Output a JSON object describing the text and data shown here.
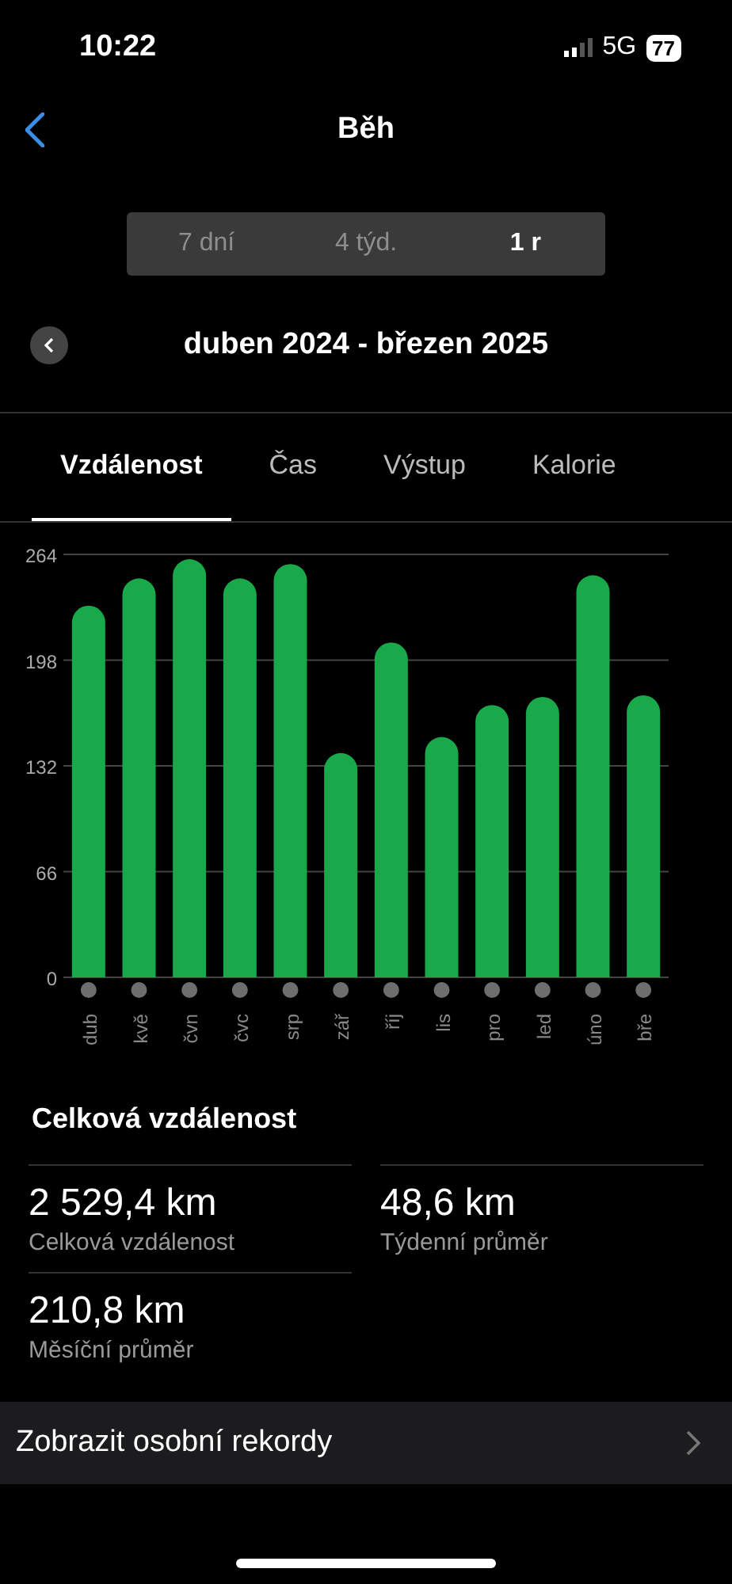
{
  "status_bar": {
    "time": "10:22",
    "network": "5G",
    "battery": "77"
  },
  "header": {
    "title": "Běh"
  },
  "range_tabs": [
    {
      "label": "7 dní",
      "selected": false
    },
    {
      "label": "4 týd.",
      "selected": false
    },
    {
      "label": "1 r",
      "selected": true
    }
  ],
  "period": {
    "label": "duben 2024 - březen 2025"
  },
  "metric_tabs": [
    {
      "label": "Vzdálenost",
      "selected": true
    },
    {
      "label": "Čas",
      "selected": false
    },
    {
      "label": "Výstup",
      "selected": false
    },
    {
      "label": "Kalorie",
      "selected": false
    }
  ],
  "chart_data": {
    "type": "bar",
    "categories": [
      "dub",
      "kvě",
      "čvn",
      "čvc",
      "srp",
      "zář",
      "říj",
      "lis",
      "pro",
      "led",
      "úno",
      "bře"
    ],
    "grid": true,
    "series": [
      {
        "color": "#19a84a",
        "values": [
          232,
          249,
          261,
          249,
          258,
          140,
          209,
          150,
          170,
          175,
          251,
          176
        ]
      }
    ],
    "ylim": [
      0,
      264
    ],
    "yticks": [
      0,
      66,
      132,
      198,
      264
    ]
  },
  "summary": {
    "title": "Celková vzdálenost",
    "stats": [
      {
        "value": "2 529,4 km",
        "label": "Celková vzdálenost"
      },
      {
        "value": "48,6 km",
        "label": "Týdenní průměr"
      },
      {
        "value": "210,8 km",
        "label": "Měsíční průměr"
      }
    ]
  },
  "records_link": {
    "label": "Zobrazit osobní rekordy"
  }
}
